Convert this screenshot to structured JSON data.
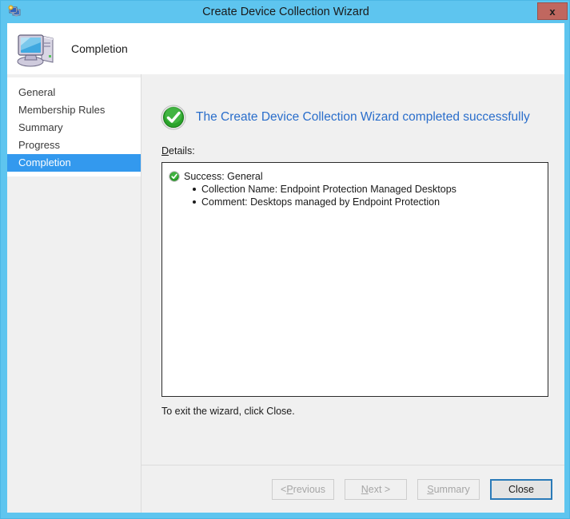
{
  "window": {
    "title": "Create Device Collection Wizard",
    "icon": "device-collection-icon",
    "close_label": "x",
    "border_color": "#5ec5ef",
    "close_button_color": "#c0675f"
  },
  "header": {
    "title": "Completion",
    "icon": "computer-icon"
  },
  "sidebar": {
    "items": [
      {
        "label": "General",
        "selected": false
      },
      {
        "label": "Membership Rules",
        "selected": false
      },
      {
        "label": "Summary",
        "selected": false
      },
      {
        "label": "Progress",
        "selected": false
      },
      {
        "label": "Completion",
        "selected": true
      }
    ],
    "selected_color": "#3399ee"
  },
  "main": {
    "status_icon": "success-check-icon",
    "status_text": "The Create Device Collection Wizard completed successfully",
    "status_text_color": "#2a6ecb",
    "details_label_prefix": "D",
    "details_label_rest": "etails:",
    "details": [
      {
        "icon": "success-check-icon",
        "heading": "Success: General",
        "bullets": [
          "Collection Name: Endpoint Protection Managed Desktops",
          "Comment: Desktops managed by Endpoint Protection"
        ]
      }
    ],
    "exit_note": "To exit the wizard, click Close."
  },
  "footer": {
    "buttons": [
      {
        "id": "previous",
        "prefix": "< ",
        "accel": "P",
        "suffix": "revious",
        "enabled": false
      },
      {
        "id": "next",
        "prefix": "",
        "accel": "N",
        "suffix": "ext >",
        "enabled": false
      },
      {
        "id": "summary",
        "prefix": "",
        "accel": "S",
        "suffix": "ummary",
        "enabled": false
      },
      {
        "id": "close",
        "prefix": "",
        "accel": "",
        "suffix": "Close",
        "enabled": true
      }
    ]
  }
}
